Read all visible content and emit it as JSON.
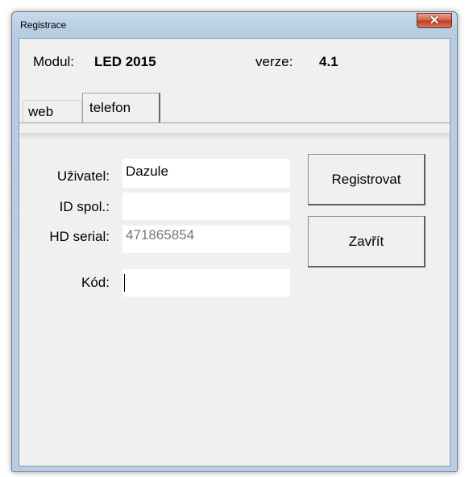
{
  "window": {
    "title": "Registrace",
    "close_glyph": "✕"
  },
  "header": {
    "modul_label": "Modul:",
    "modul_value": "LED 2015",
    "verze_label": "verze:",
    "verze_value": "4.1"
  },
  "tabs": [
    {
      "label": "web",
      "active": false
    },
    {
      "label": "telefon",
      "active": true
    }
  ],
  "form": {
    "user_label": "Uživatel:",
    "user_value": "Dazule",
    "company_label": "ID spol.:",
    "company_value": "",
    "hd_label": "HD serial:",
    "hd_value": "471865854",
    "code_label": "Kód:",
    "code_value": ""
  },
  "buttons": {
    "register_label": "Registrovat",
    "close_label": "Zavřít"
  }
}
